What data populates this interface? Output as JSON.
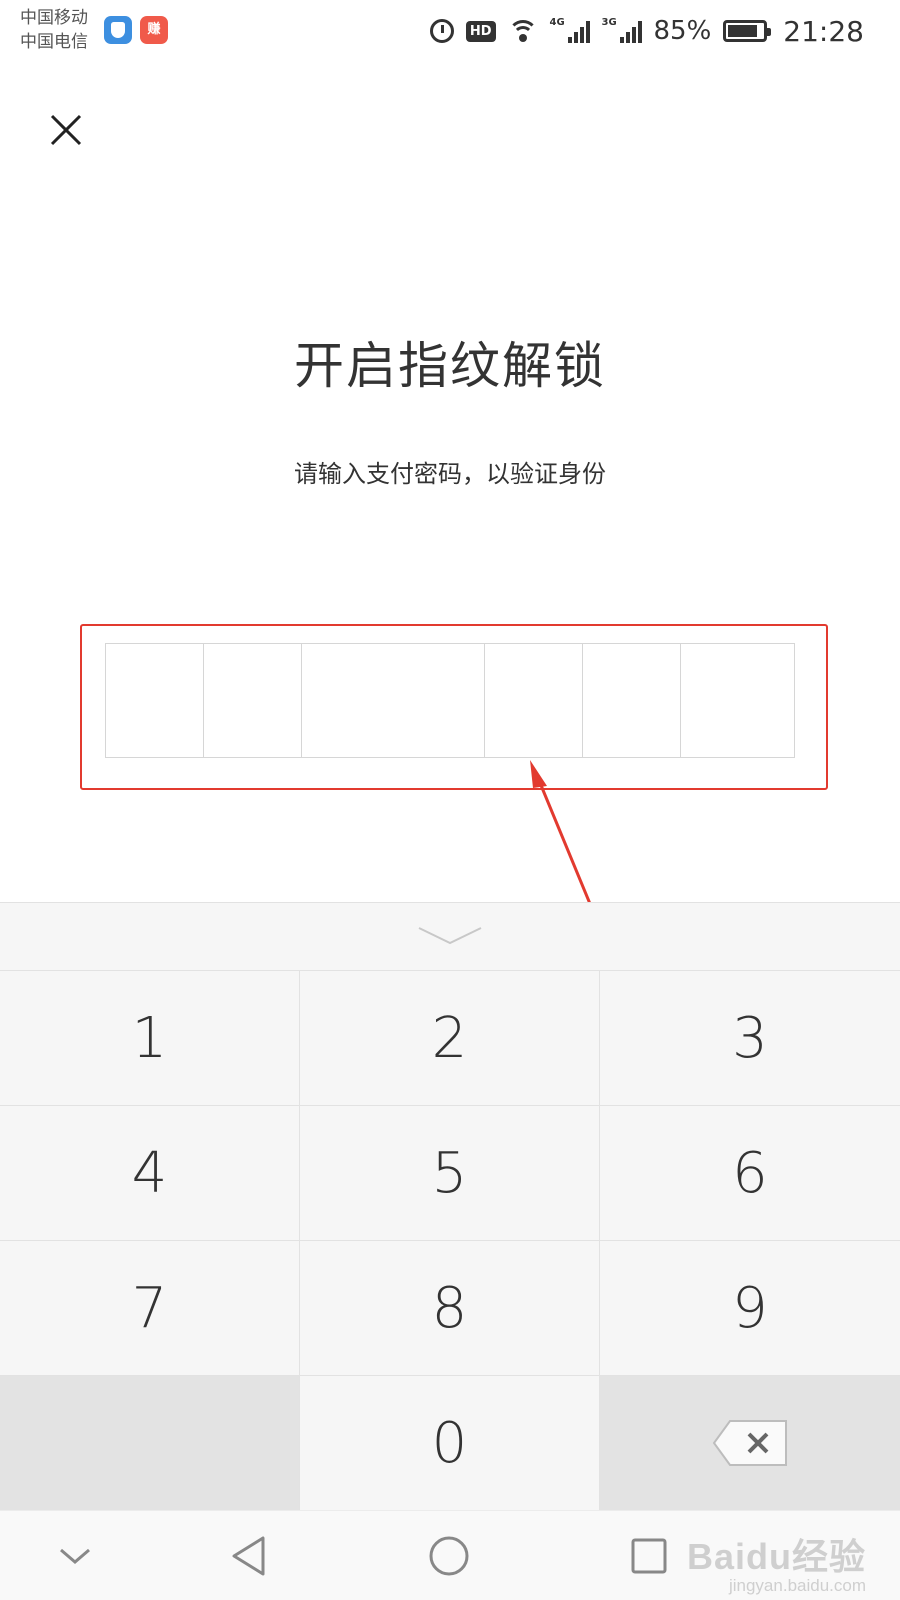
{
  "status_bar": {
    "carrier_1": "中国移动",
    "carrier_2": "中国电信",
    "app_badge": "赚",
    "hd_label": "HD",
    "signal_1_type": "4G",
    "signal_2_type": "3G",
    "battery_percent": "85%",
    "battery_level": 0.85,
    "time": "21:28",
    "icons": [
      "shield-icon",
      "app-icon",
      "alarm-icon",
      "hd-icon",
      "wifi-icon",
      "signal-icon",
      "battery-icon"
    ]
  },
  "header": {
    "close_icon": "close-icon"
  },
  "main": {
    "title": "开启指纹解锁",
    "subtitle": "请输入支付密码，以验证身份",
    "pin_length": 6,
    "highlight_color": "#e23a2f"
  },
  "keypad": {
    "collapse_icon": "chevron-down-icon",
    "keys": [
      "1",
      "2",
      "3",
      "4",
      "5",
      "6",
      "7",
      "8",
      "9",
      "",
      "0",
      "⌫"
    ],
    "delete_icon": "backspace-icon"
  },
  "navbar": {
    "buttons": [
      "chevron-down-icon",
      "back-icon",
      "home-icon",
      "recents-icon"
    ]
  },
  "watermark": {
    "logo": "Baidu经验",
    "url": "jingyan.baidu.com"
  }
}
